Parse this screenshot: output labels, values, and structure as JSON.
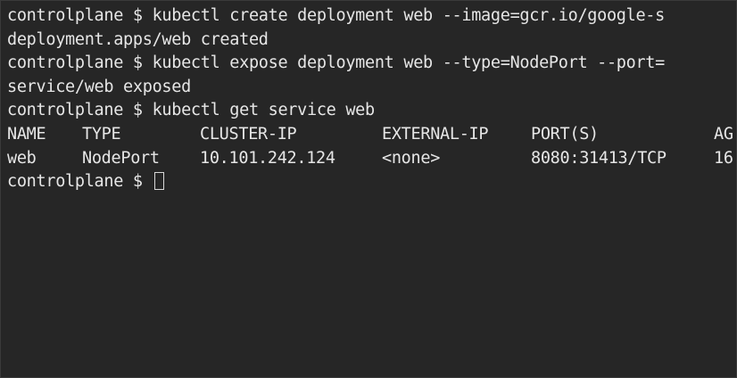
{
  "terminal": {
    "lines": [
      "controlplane $ kubectl create deployment web --image=gcr.io/google-s",
      "deployment.apps/web created",
      "controlplane $ kubectl expose deployment web --type=NodePort --port=",
      "service/web exposed",
      "controlplane $ kubectl get service web"
    ],
    "table": {
      "headers": [
        "NAME",
        "TYPE",
        "CLUSTER-IP",
        "EXTERNAL-IP",
        "PORT(S)",
        "AG"
      ],
      "rows": [
        [
          "web",
          "NodePort",
          "10.101.242.124",
          "<none>",
          "8080:31413/TCP",
          "16"
        ]
      ]
    },
    "prompt": "controlplane $ "
  }
}
